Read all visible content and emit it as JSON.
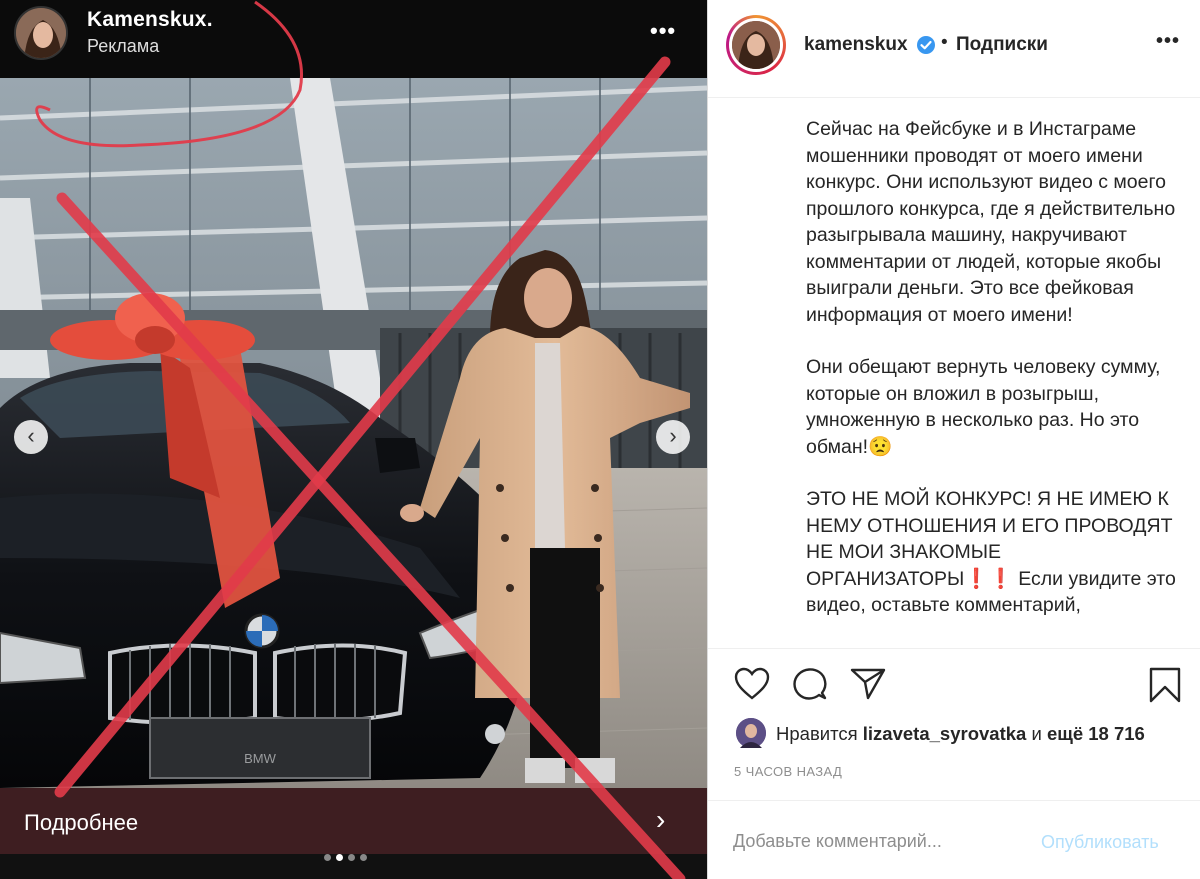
{
  "story": {
    "username": "Kamenskux.",
    "sponsored_label": "Реклама",
    "more_icon": "more-horizontal-icon",
    "cta_label": "Подробнее",
    "cta_icon": "chevron-right-icon",
    "prev_icon": "chevron-left-icon",
    "next_icon": "chevron-right-icon",
    "plate_text": "BMW",
    "slide_count": 4,
    "active_slide": 2,
    "overlay_color": "#e23b4a"
  },
  "post": {
    "username": "kamenskux",
    "verified_icon": "verified-badge-icon",
    "separator": "•",
    "follow_label": "Подписки",
    "more_icon": "more-horizontal-icon",
    "caption": [
      "Сейчас на Фейсбуке и в Инстаграме мошенники проводят от моего имени конкурс. Они используют видео с моего прошлого конкурса, где я действительно разыгрывала машину, накручивают комментарии от людей, которые якобы выиграли деньги. Это все фейковая информация от моего имени!",
      "Они обещают вернуть человеку сумму, которые он вложил в розыгрыш, умноженную в несколько раз. Но это обман!😟",
      "ЭТО НЕ МОЙ КОНКУРС! Я НЕ ИМЕЮ К НЕМУ ОТНОШЕНИЯ И ЕГО ПРОВОДЯТ НЕ МОИ ЗНАКОМЫЕ ОРГАНИЗАТОРЫ❗️❗️ Если увидите это видео, оставьте комментарий,"
    ],
    "actions": {
      "like_icon": "heart-icon",
      "comment_icon": "comment-icon",
      "share_icon": "share-icon",
      "save_icon": "bookmark-icon"
    },
    "likes": {
      "prefix": "Нравится",
      "user": "lizaveta_syrovatka",
      "conjunction": "и",
      "others": "ещё 18 716"
    },
    "timestamp": "5 ЧАСОВ НАЗАД",
    "comment_placeholder": "Добавьте комментарий...",
    "publish_label": "Опубликовать",
    "accent_color": "#0095f6"
  }
}
